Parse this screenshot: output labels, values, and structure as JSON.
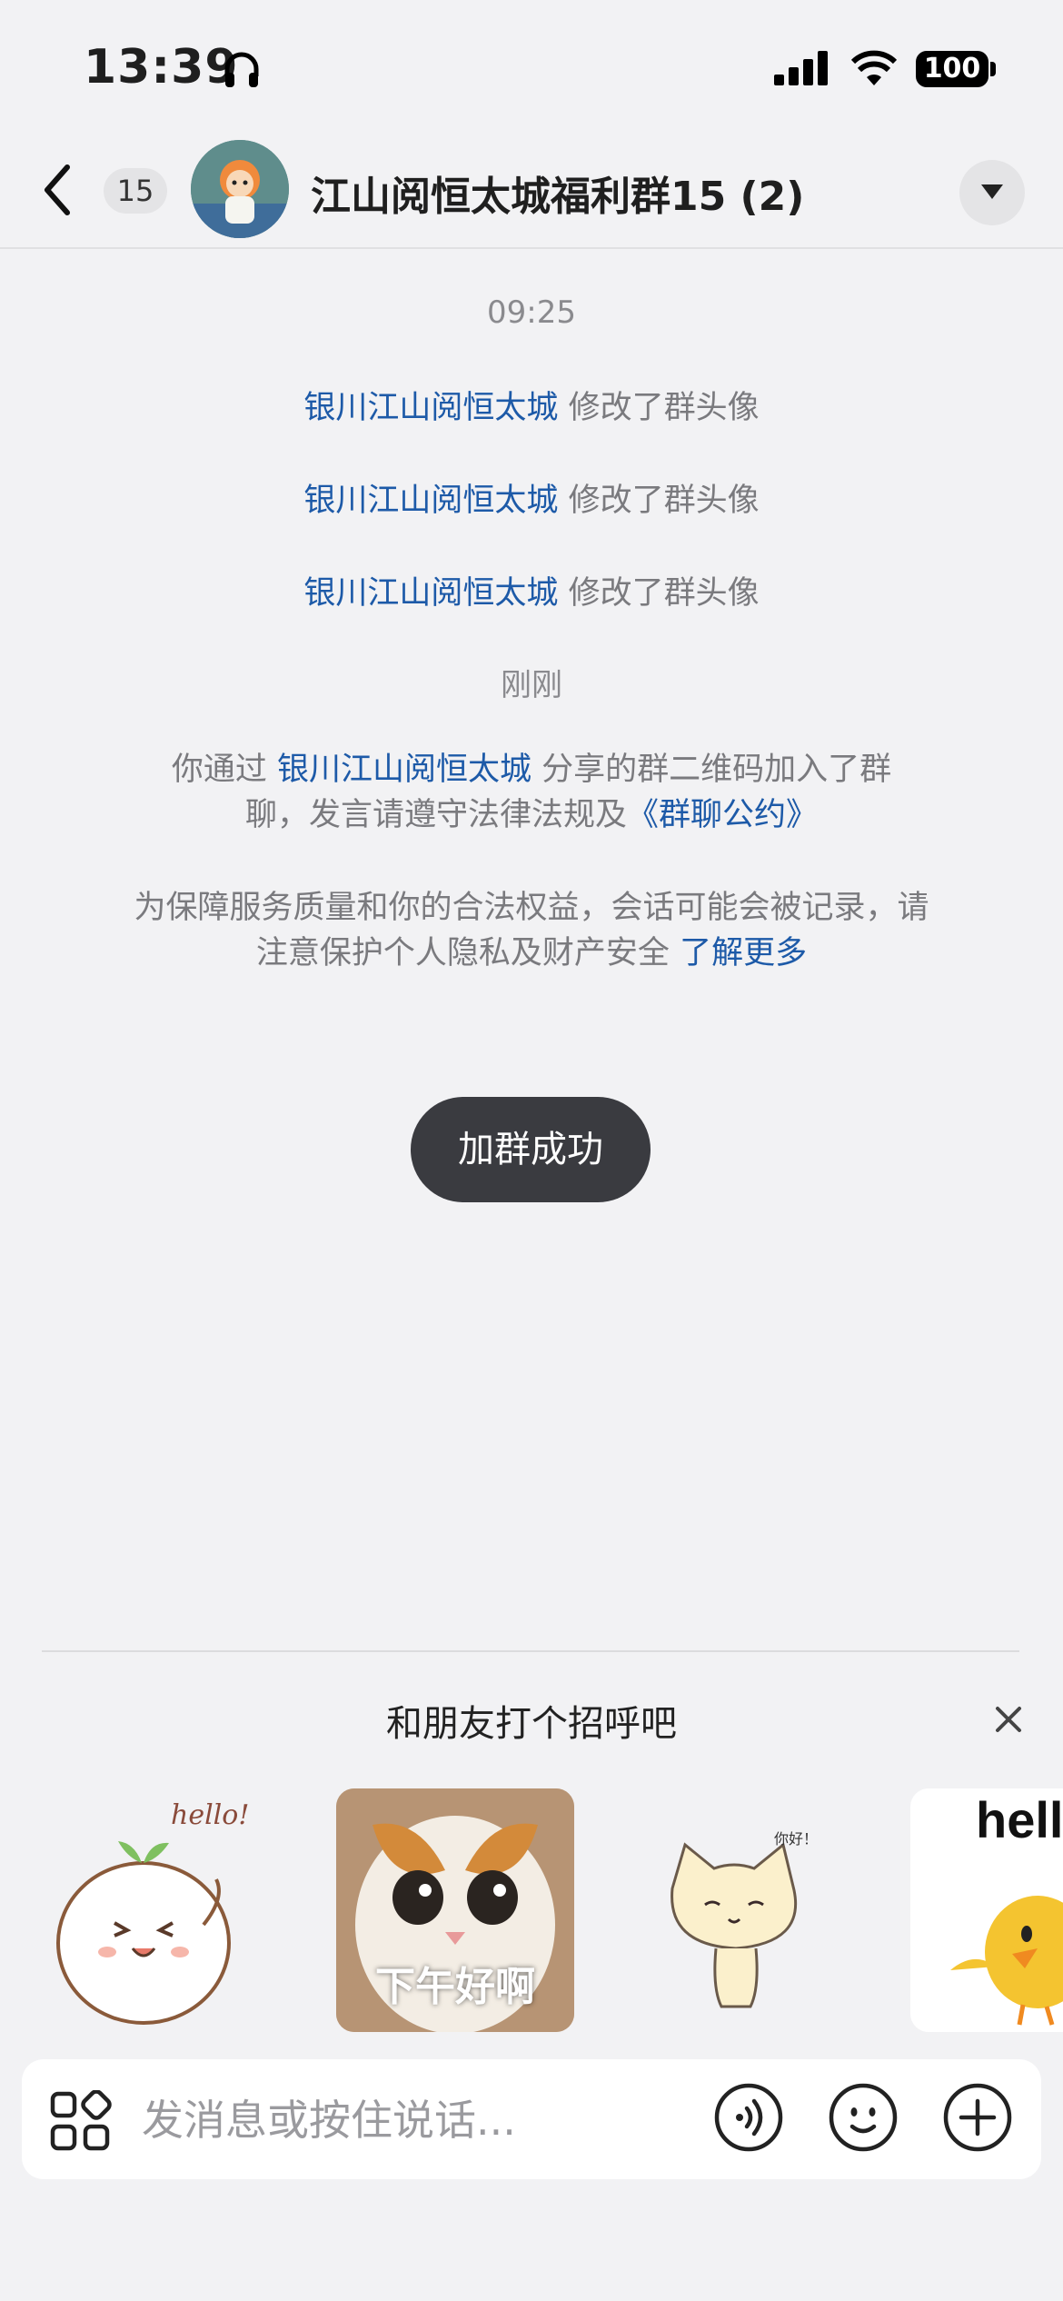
{
  "status_bar": {
    "time": "13:39",
    "battery": "100"
  },
  "nav": {
    "unread_count": "15",
    "group_title": "江山阅恒太城福利群15 (2)"
  },
  "chat": {
    "first_time": "09:25",
    "avatar_changes": [
      {
        "user": "银川江山阅恒太城",
        "action": "修改了群头像"
      },
      {
        "user": "银川江山阅恒太城",
        "action": "修改了群头像"
      },
      {
        "user": "银川江山阅恒太城",
        "action": "修改了群头像"
      }
    ],
    "second_time": "刚刚",
    "join_notice": {
      "prefix": "你通过",
      "user": "银川江山阅恒太城",
      "middle": "分享的群二维码加入了群聊，发言请遵守法律法规及",
      "link": "《群聊公约》"
    },
    "privacy_notice": {
      "text": "为保障服务质量和你的合法权益，会话可能会被记录，请注意保护个人隐私及财产安全",
      "link": "了解更多"
    },
    "toast": "加群成功"
  },
  "greeting": {
    "title": "和朋友打个招呼吧",
    "stickers": [
      {
        "name": "sprout-hello",
        "text": "hello!"
      },
      {
        "name": "cat-photo",
        "caption": "下午好啊"
      },
      {
        "name": "cat-cartoon",
        "text": "你好！"
      },
      {
        "name": "chick-hello",
        "text": "hello"
      }
    ]
  },
  "input_bar": {
    "placeholder": "发消息或按住说话..."
  },
  "colors": {
    "background": "#f2f2f4",
    "link": "#1d5aa8",
    "toast": "#3a3b40"
  }
}
